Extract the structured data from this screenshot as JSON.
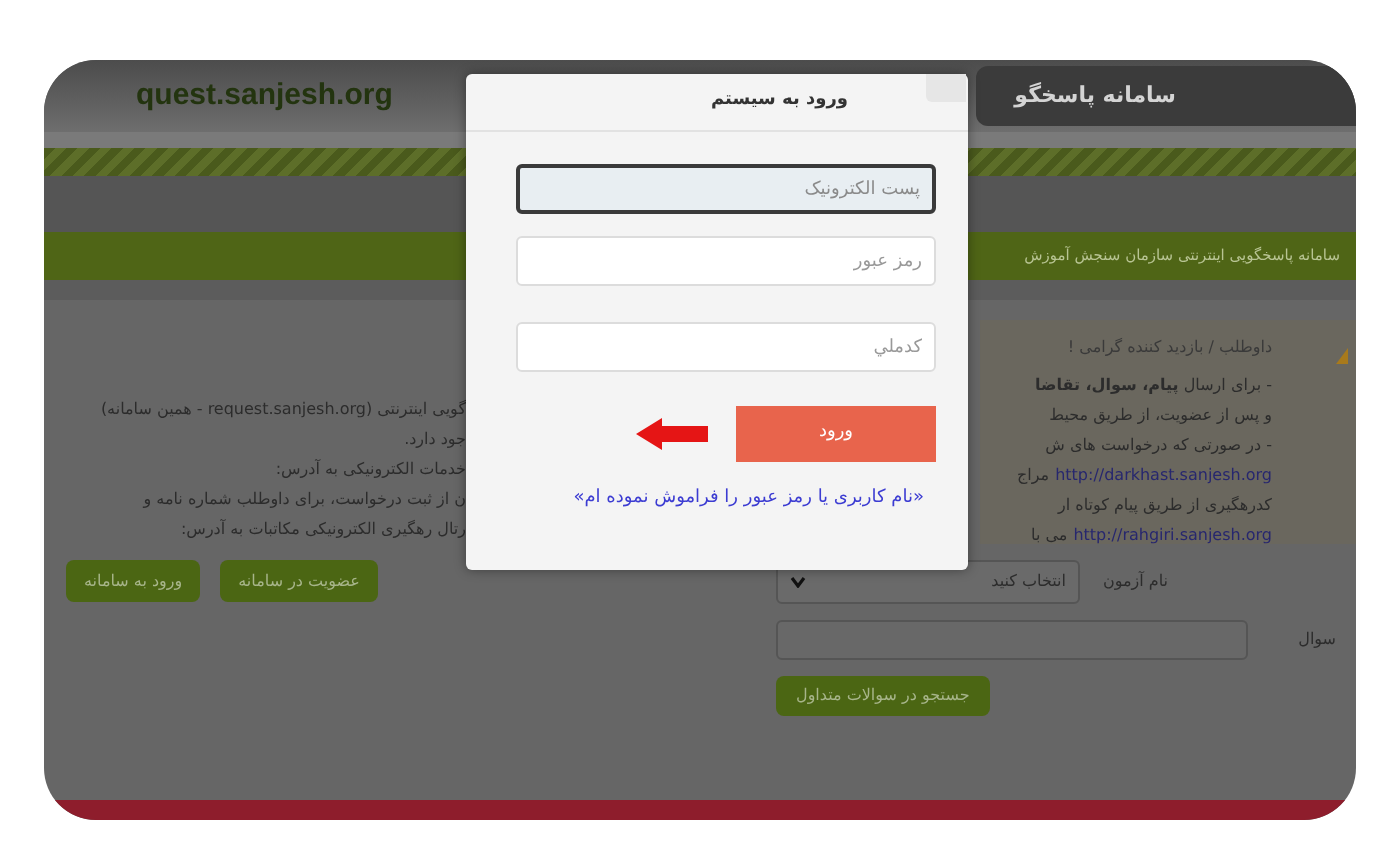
{
  "header": {
    "site_address": "quest.sanjesh.org",
    "banner_title": "سامانه پاسخگو"
  },
  "nav_bar": {
    "title": "سامانه پاسخگویی اینترنتی سازمان سنجش آموزش"
  },
  "notice": {
    "greeting": "داوطلب / بازدید کننده گرامی !",
    "lines": [
      {
        "segments": [
          {
            "kind": "text",
            "text": "- برای ارسال **پیام، سوال، تقاضا**"
          }
        ]
      },
      {
        "segments": [
          {
            "kind": "text",
            "text": "و پس از عضویت، از طریق محیط"
          }
        ]
      },
      {
        "segments": [
          {
            "kind": "text",
            "text": "- در صورتی که درخواست های ش"
          }
        ]
      },
      {
        "segments": [
          {
            "kind": "link",
            "text": "http://darkhast.sanjesh.org"
          },
          {
            "kind": "text",
            "text": "مراج"
          }
        ]
      },
      {
        "segments": [
          {
            "kind": "text",
            "text": "کدرهگیری از طریق پیام کوتاه ار"
          }
        ]
      },
      {
        "segments": [
          {
            "kind": "link",
            "text": "http://rahgiri.sanjesh.org"
          },
          {
            "kind": "text",
            "text": "می با"
          }
        ]
      }
    ]
  },
  "notice_continued": [
    "گویی اینترنتی (request.sanjesh.org - همین سامانه)",
    "جود دارد.",
    "خدمات الکترونیکی به آدرس:",
    "ن از ثبت درخواست، برای داوطلب شماره نامه و",
    "رتال رهگیری الکترونیکی مکاتبات به آدرس:"
  ],
  "search_form": {
    "exam_label": "نام آزمون",
    "exam_select": "انتخاب کنید",
    "question_label": "سوال",
    "search_button": "جستجو در سوالات متداول"
  },
  "account_buttons": [
    "عضویت در سامانه",
    "ورود به سامانه"
  ],
  "login_dialog": {
    "title": "ورود به سیستم",
    "fields": [
      {
        "placeholder": "پست الکترونیک",
        "focused": true
      },
      {
        "placeholder": "رمز عبور",
        "focused": false
      },
      {
        "placeholder": "کدملي",
        "focused": false
      }
    ],
    "submit": "ورود",
    "forgot_link": "«نام کاربری یا رمز عبور را فراموش نموده ام»"
  }
}
